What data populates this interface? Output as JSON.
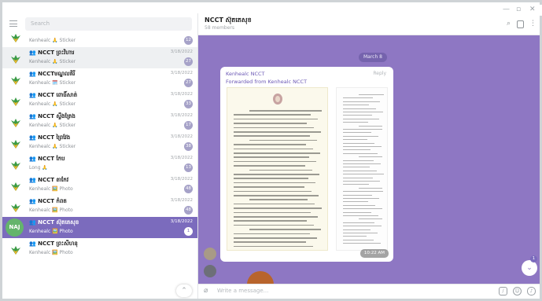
{
  "window": {
    "controls": [
      "—",
      "▫",
      "✕"
    ]
  },
  "search": {
    "placeholder": "Search"
  },
  "chats": [
    {
      "name": "",
      "preview": "Kenhealc 🙏 Sticker",
      "date": "",
      "badge": "12",
      "state": "normal"
    },
    {
      "name": "👥 NCCT ព្រះវិហារ",
      "preview": "Kenhealc 🙏 Sticker",
      "date": "3/18/2022",
      "badge": "27",
      "state": "hl"
    },
    {
      "name": "👥 NCCTមណ្ឌលគិរី",
      "preview": "Kenhealc 🗓️ Sticker",
      "date": "3/18/2022",
      "badge": "27",
      "state": "normal"
    },
    {
      "name": "👥 NCCT ពោធិ៍សាត់",
      "preview": "Kenhealc 🙏 Sticker",
      "date": "3/18/2022",
      "badge": "33",
      "state": "normal"
    },
    {
      "name": "👥 NCCT ស្ទឹងត្រែង",
      "preview": "Kenhealc 🙏 Sticker",
      "date": "3/18/2022",
      "badge": "17",
      "state": "normal"
    },
    {
      "name": "👥 NCCT ព្រៃវែង",
      "preview": "Kenhealc 🙏 Sticker",
      "date": "3/18/2022",
      "badge": "38",
      "state": "normal"
    },
    {
      "name": "👥 NCCT កែប",
      "preview": "Long 🙏",
      "date": "3/18/2022",
      "badge": "13",
      "state": "normal"
    },
    {
      "name": "👥 NCCT តាកែវ",
      "preview": "Kenhealc 🖼️ Photo",
      "date": "3/18/2022",
      "badge": "48",
      "state": "normal"
    },
    {
      "name": "👥 NCCT កំពត",
      "preview": "Kenhealc 🖼️ Photo",
      "date": "3/18/2022",
      "badge": "48",
      "state": "normal"
    },
    {
      "name": "👥 NCCT ស៊ុតតេសុខ",
      "preview": "Kenhealc 🖼️ Photo",
      "date": "3/18/2022",
      "badge": "1",
      "state": "sel",
      "avatar_text": "NAJ"
    },
    {
      "name": "👥 NCCT ព្រះសីហនុ",
      "preview": "Kenhealc 🖼️ Photo",
      "date": "",
      "badge": "",
      "state": "normal"
    }
  ],
  "header": {
    "title": "NCCT ស៊ុតតេសុខ",
    "subtitle": "58 members"
  },
  "messages": {
    "date_pill": "March 8",
    "sender": "Kenhealc NCCT",
    "forwarded": "Forwarded from Kenhealc NCCT",
    "reply_label": "Reply",
    "time": "10:22 AM",
    "down_badge": "1"
  },
  "composer": {
    "placeholder": "Write a message..."
  },
  "colors": {
    "accent": "#7b6bbd",
    "chat_bg": "#8e77c3",
    "logo_green": "#2e8b3d"
  }
}
